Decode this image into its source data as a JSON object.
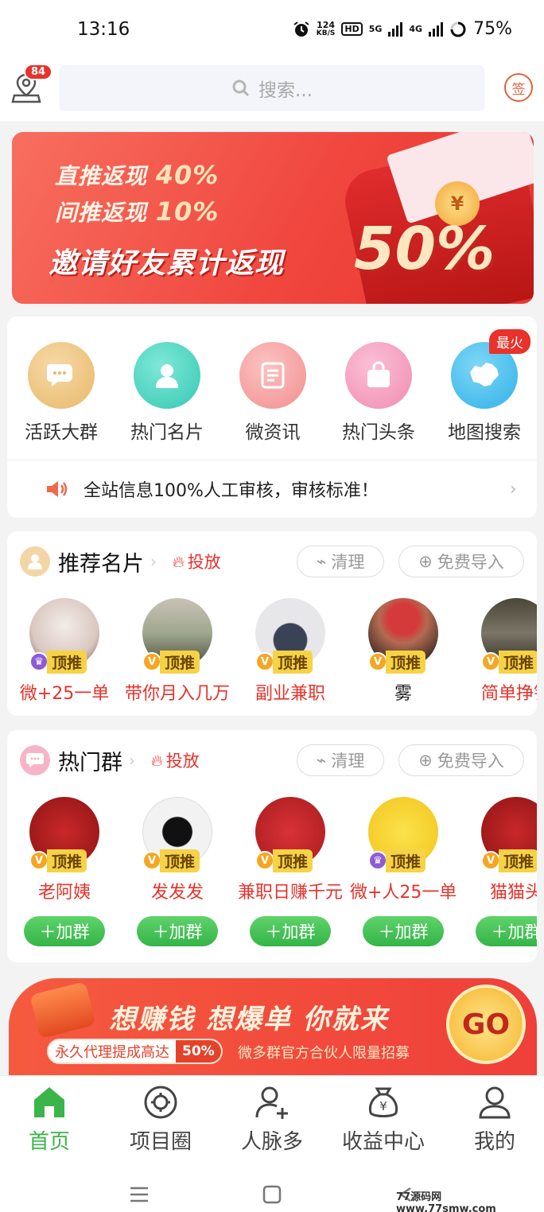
{
  "status_bar": {
    "time": "13:16",
    "net_speed_value": "124",
    "net_speed_unit": "KB/S",
    "hd": "HD",
    "sig1": "5G",
    "sig2": "4G",
    "battery": "75%"
  },
  "header": {
    "message_count": "84",
    "search_placeholder": "搜索...",
    "sign_label": "签"
  },
  "banner_top": {
    "line1_text": "直推返现",
    "line1_pct": "40%",
    "line2_text": "间推返现",
    "line2_pct": "10%",
    "headline": "邀请好友累计返现",
    "big_pct": "50%",
    "coin_symbol": "¥"
  },
  "categories": {
    "hot_badge": "最火",
    "items": [
      {
        "label": "活跃大群",
        "color": "#f0c785",
        "icon": "chat-bubble-icon"
      },
      {
        "label": "热门名片",
        "color": "#4fd6c4",
        "icon": "person-icon"
      },
      {
        "label": "微资讯",
        "color": "#f7a6a6",
        "icon": "news-icon"
      },
      {
        "label": "热门头条",
        "color": "#f7a3c0",
        "icon": "bag-icon"
      },
      {
        "label": "地图搜索",
        "color": "#43bfee",
        "icon": "map-china-icon"
      }
    ],
    "notice": "全站信息100%人工审核，审核标准！"
  },
  "recommend": {
    "title": "推荐名片",
    "put_label": "投放",
    "clean_label": "清理",
    "import_label": "免费导入",
    "top_label": "顶推",
    "people": [
      {
        "name": "微+25一单",
        "bg": "#d9c8c0",
        "badge": "purple"
      },
      {
        "name": "带你月入几万",
        "bg": "#9fa78e",
        "badge": "gold"
      },
      {
        "name": "副业兼职",
        "bg": "#e7e7ea",
        "badge": "gold"
      },
      {
        "name": "雾",
        "bg": "#b36b52",
        "badge": "gold"
      },
      {
        "name": "简单挣钱",
        "bg": "#7a7566",
        "badge": "gold"
      }
    ]
  },
  "groups": {
    "title": "热门群",
    "put_label": "投放",
    "clean_label": "清理",
    "import_label": "免费导入",
    "top_label": "顶推",
    "join_label": "加群",
    "items": [
      {
        "name": "老阿姨",
        "bg": "#b51d1d",
        "badge": "gold"
      },
      {
        "name": "发发发",
        "bg": "#f2f2f2",
        "badge": "gold"
      },
      {
        "name": "兼职日赚千元",
        "bg": "#c8262a",
        "badge": "gold"
      },
      {
        "name": "微+人25一单",
        "bg": "#f6d630",
        "badge": "purple"
      },
      {
        "name": "猫猫头",
        "bg": "#b51d1d",
        "badge": "gold"
      }
    ]
  },
  "banner_bottom": {
    "title": "想赚钱 想爆单 你就来",
    "pill_text": "永久代理提成高达",
    "pill_pct": "50%",
    "subtitle": "微多群官方合伙人限量招募",
    "go_label": "GO"
  },
  "tabbar": {
    "items": [
      {
        "label": "首页",
        "icon": "home-icon",
        "active": true
      },
      {
        "label": "项目圈",
        "icon": "gear-circle-icon",
        "active": false
      },
      {
        "label": "人脉多",
        "icon": "add-person-icon",
        "active": false
      },
      {
        "label": "收益中心",
        "icon": "money-bag-icon",
        "active": false
      },
      {
        "label": "我的",
        "icon": "profile-icon",
        "active": false
      }
    ]
  },
  "watermark": "77源码网 www.77smw.com"
}
